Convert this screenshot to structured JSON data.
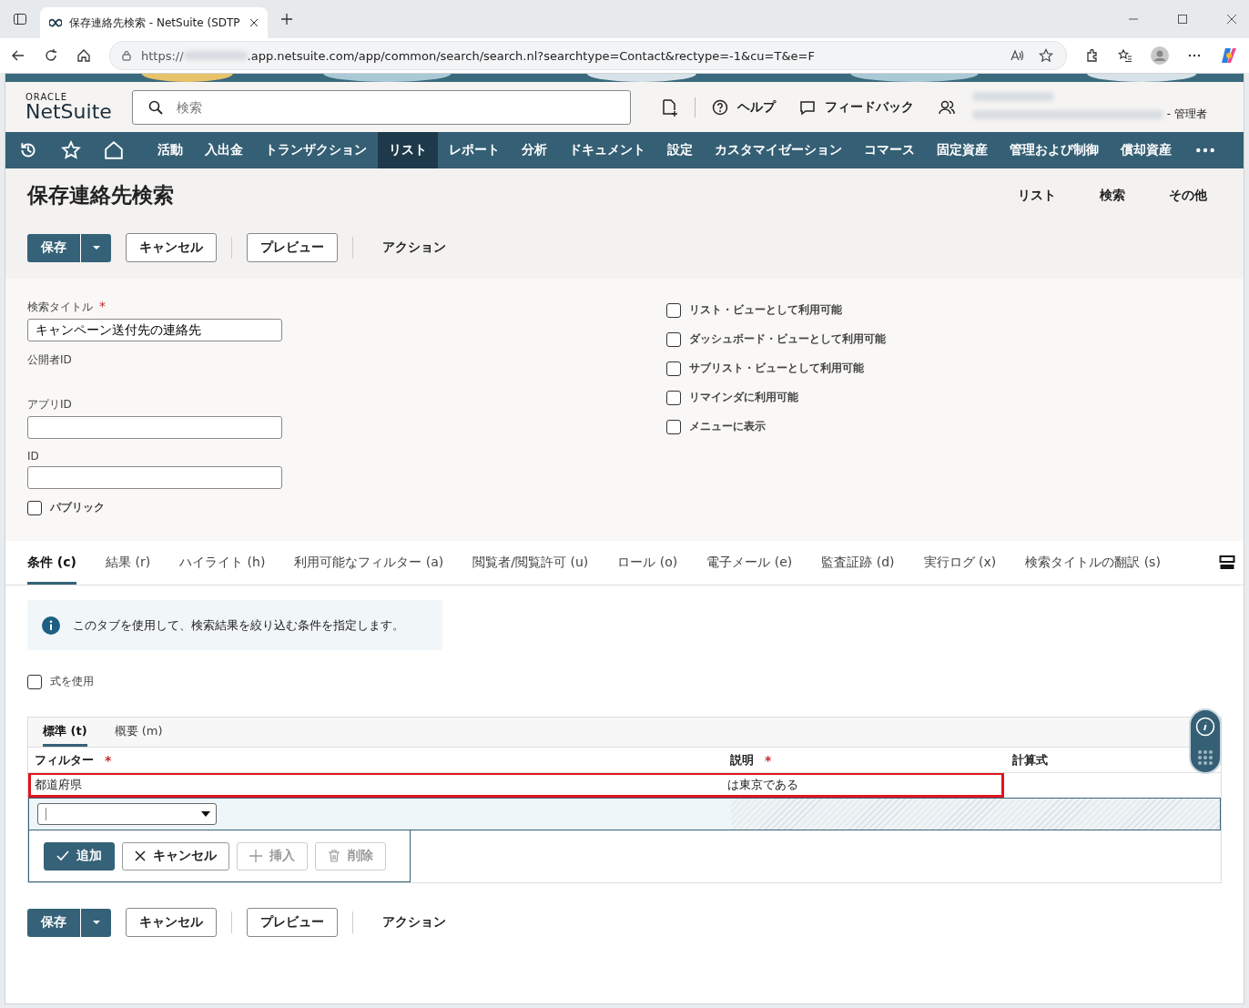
{
  "browser": {
    "tab_title": "保存連絡先検索 - NetSuite (SDTP",
    "url_prefix": "https://",
    "url_rest": ".app.netsuite.com/app/common/search/search.nl?searchtype=Contact&rectype=-1&cu=T&e=F"
  },
  "header": {
    "logo_top": "ORACLE",
    "logo": "NetSuite",
    "search_placeholder": "検索",
    "help": "ヘルプ",
    "feedback": "フィードバック",
    "role": "- 管理者"
  },
  "nav": [
    {
      "label": "活動",
      "selected": false
    },
    {
      "label": "入出金",
      "selected": false
    },
    {
      "label": "トランザクション",
      "selected": false
    },
    {
      "label": "リスト",
      "selected": true
    },
    {
      "label": "レポート",
      "selected": false
    },
    {
      "label": "分析",
      "selected": false
    },
    {
      "label": "ドキュメント",
      "selected": false
    },
    {
      "label": "設定",
      "selected": false
    },
    {
      "label": "カスタマイゼーション",
      "selected": false
    },
    {
      "label": "コマース",
      "selected": false
    },
    {
      "label": "固定資産",
      "selected": false
    },
    {
      "label": "管理および制御",
      "selected": false
    },
    {
      "label": "償却資産",
      "selected": false
    }
  ],
  "page": {
    "title": "保存連絡先検索",
    "links": [
      "リスト",
      "検索",
      "その他"
    ]
  },
  "top_actions": {
    "save": "保存",
    "cancel": "キャンセル",
    "preview": "プレビュー",
    "action": "アクション"
  },
  "form": {
    "title_label": "検索タイトル",
    "title_mark": "*",
    "title_value": "キャンペーン送付先の連絡先",
    "publisher_label": "公開者ID",
    "app_id_label": "アプリID",
    "id_label": "ID",
    "public": {
      "label": "パブリック",
      "checked": false
    },
    "options": [
      {
        "label": "リスト・ビューとして利用可能",
        "checked": false
      },
      {
        "label": "ダッシュボード・ビューとして利用可能",
        "checked": false
      },
      {
        "label": "サブリスト・ビューとして利用可能",
        "checked": false
      },
      {
        "label": "リマインダに利用可能",
        "checked": false
      },
      {
        "label": "メニューに表示",
        "checked": false
      }
    ]
  },
  "subtabs": [
    {
      "label": "条件 (c)",
      "selected": true
    },
    {
      "label": "結果 (r)",
      "selected": false
    },
    {
      "label": "ハイライト (h)",
      "selected": false
    },
    {
      "label": "利用可能なフィルター (a)",
      "selected": false
    },
    {
      "label": "閲覧者/閲覧許可 (u)",
      "selected": false
    },
    {
      "label": "ロール (o)",
      "selected": false
    },
    {
      "label": "電子メール (e)",
      "selected": false
    },
    {
      "label": "監査証跡 (d)",
      "selected": false
    },
    {
      "label": "実行ログ (x)",
      "selected": false
    },
    {
      "label": "検索タイトルの翻訳 (s)",
      "selected": false
    }
  ],
  "info": "このタブを使用して、検索結果を絞り込む条件を指定します。",
  "formula": {
    "label": "式を使用",
    "checked": false
  },
  "criteria": {
    "tabs": [
      {
        "label": "標準 (t)",
        "selected": true
      },
      {
        "label": "概要 (m)",
        "selected": false
      }
    ],
    "columns": [
      {
        "label": "フィルター",
        "mark": "*"
      },
      {
        "label": "説明",
        "mark": "*"
      },
      {
        "label": "計算式"
      }
    ],
    "rows": [
      {
        "filter": "都道府県",
        "description": "は東京である",
        "highlighted": true
      }
    ],
    "buttons": [
      {
        "label": "追加",
        "kind": "primary",
        "disabled": false
      },
      {
        "label": "キャンセル",
        "kind": "close",
        "disabled": false
      },
      {
        "label": "挿入",
        "kind": "plus",
        "disabled": true
      },
      {
        "label": "削除",
        "kind": "trash",
        "disabled": true
      }
    ]
  },
  "bottom_actions": {
    "save": "保存",
    "cancel": "キャンセル",
    "preview": "プレビュー",
    "action": "アクション"
  }
}
